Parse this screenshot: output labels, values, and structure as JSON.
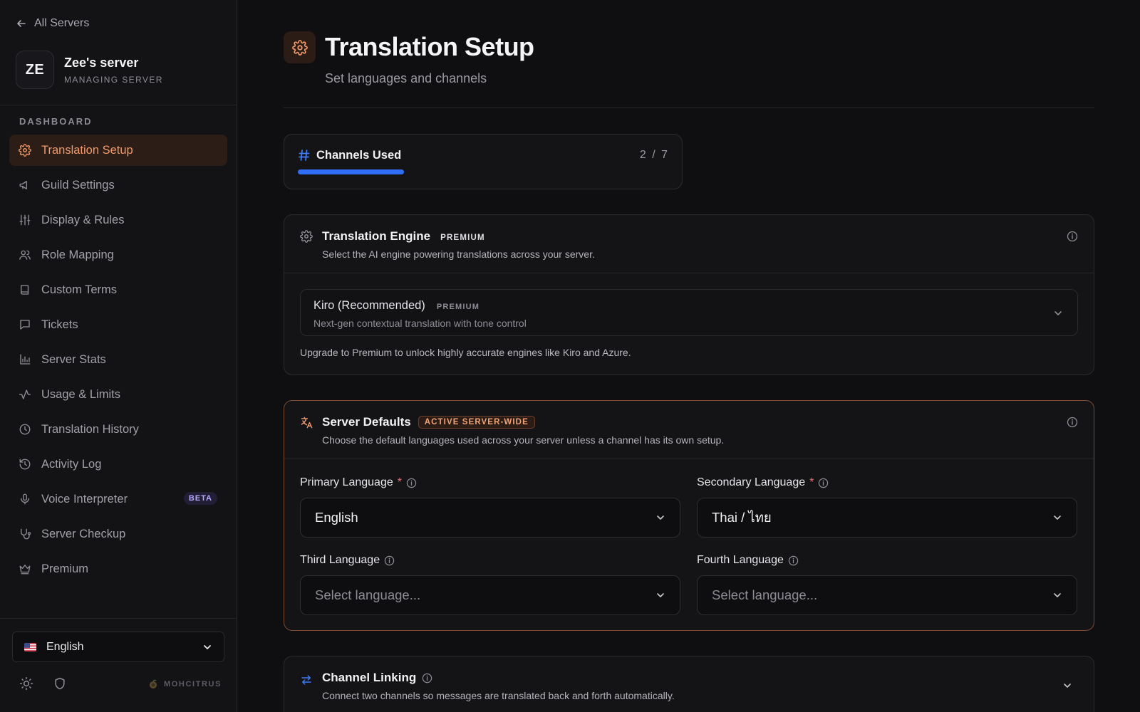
{
  "sidebar": {
    "back_label": "All Servers",
    "server": {
      "initials": "ZE",
      "name": "Zee's server",
      "subtitle": "MANAGING SERVER"
    },
    "section_label": "DASHBOARD",
    "items": [
      {
        "label": "Translation Setup",
        "icon": "gear-icon",
        "active": true
      },
      {
        "label": "Guild Settings",
        "icon": "megaphone-icon"
      },
      {
        "label": "Display & Rules",
        "icon": "sliders-icon"
      },
      {
        "label": "Role Mapping",
        "icon": "users-icon"
      },
      {
        "label": "Custom Terms",
        "icon": "book-icon"
      },
      {
        "label": "Tickets",
        "icon": "chat-icon"
      },
      {
        "label": "Server Stats",
        "icon": "bar-chart-icon"
      },
      {
        "label": "Usage & Limits",
        "icon": "activity-icon"
      },
      {
        "label": "Translation History",
        "icon": "clock-icon"
      },
      {
        "label": "Activity Log",
        "icon": "history-icon"
      },
      {
        "label": "Voice Interpreter",
        "icon": "mic-icon",
        "badge": "BETA"
      },
      {
        "label": "Server Checkup",
        "icon": "stethoscope-icon"
      },
      {
        "label": "Premium",
        "icon": "crown-icon"
      }
    ],
    "language_select": {
      "value": "English",
      "flag": "us-flag-icon"
    },
    "brand": "MOHCITRUS"
  },
  "header": {
    "title": "Translation Setup",
    "subtitle": "Set languages and channels"
  },
  "channels_used": {
    "title": "Channels Used",
    "used": "2",
    "separator": "/",
    "total": "7",
    "fraction": 0.2857
  },
  "engine": {
    "title": "Translation Engine",
    "tag": "PREMIUM",
    "description": "Select the AI engine powering translations across your server.",
    "selected": {
      "name": "Kiro (Recommended)",
      "tag": "PREMIUM",
      "description": "Next-gen contextual translation with tone control"
    },
    "note": "Upgrade to Premium to unlock highly accurate engines like Kiro and Azure."
  },
  "defaults": {
    "title": "Server Defaults",
    "badge": "ACTIVE SERVER-WIDE",
    "description": "Choose the default languages used across your server unless a channel has its own setup.",
    "primary": {
      "label": "Primary Language",
      "required": "*",
      "value": "English"
    },
    "secondary": {
      "label": "Secondary Language",
      "required": "*",
      "value": "Thai / ไทย"
    },
    "third": {
      "label": "Third Language",
      "placeholder": "Select language..."
    },
    "fourth": {
      "label": "Fourth Language",
      "placeholder": "Select language..."
    }
  },
  "linking": {
    "title": "Channel Linking",
    "description": "Connect two channels so messages are translated back and forth automatically."
  },
  "colors": {
    "accent": "#f29a6b",
    "progress": "#2f6ef5",
    "active_border": "#7a4a33",
    "beta": "#b7a8ff"
  }
}
